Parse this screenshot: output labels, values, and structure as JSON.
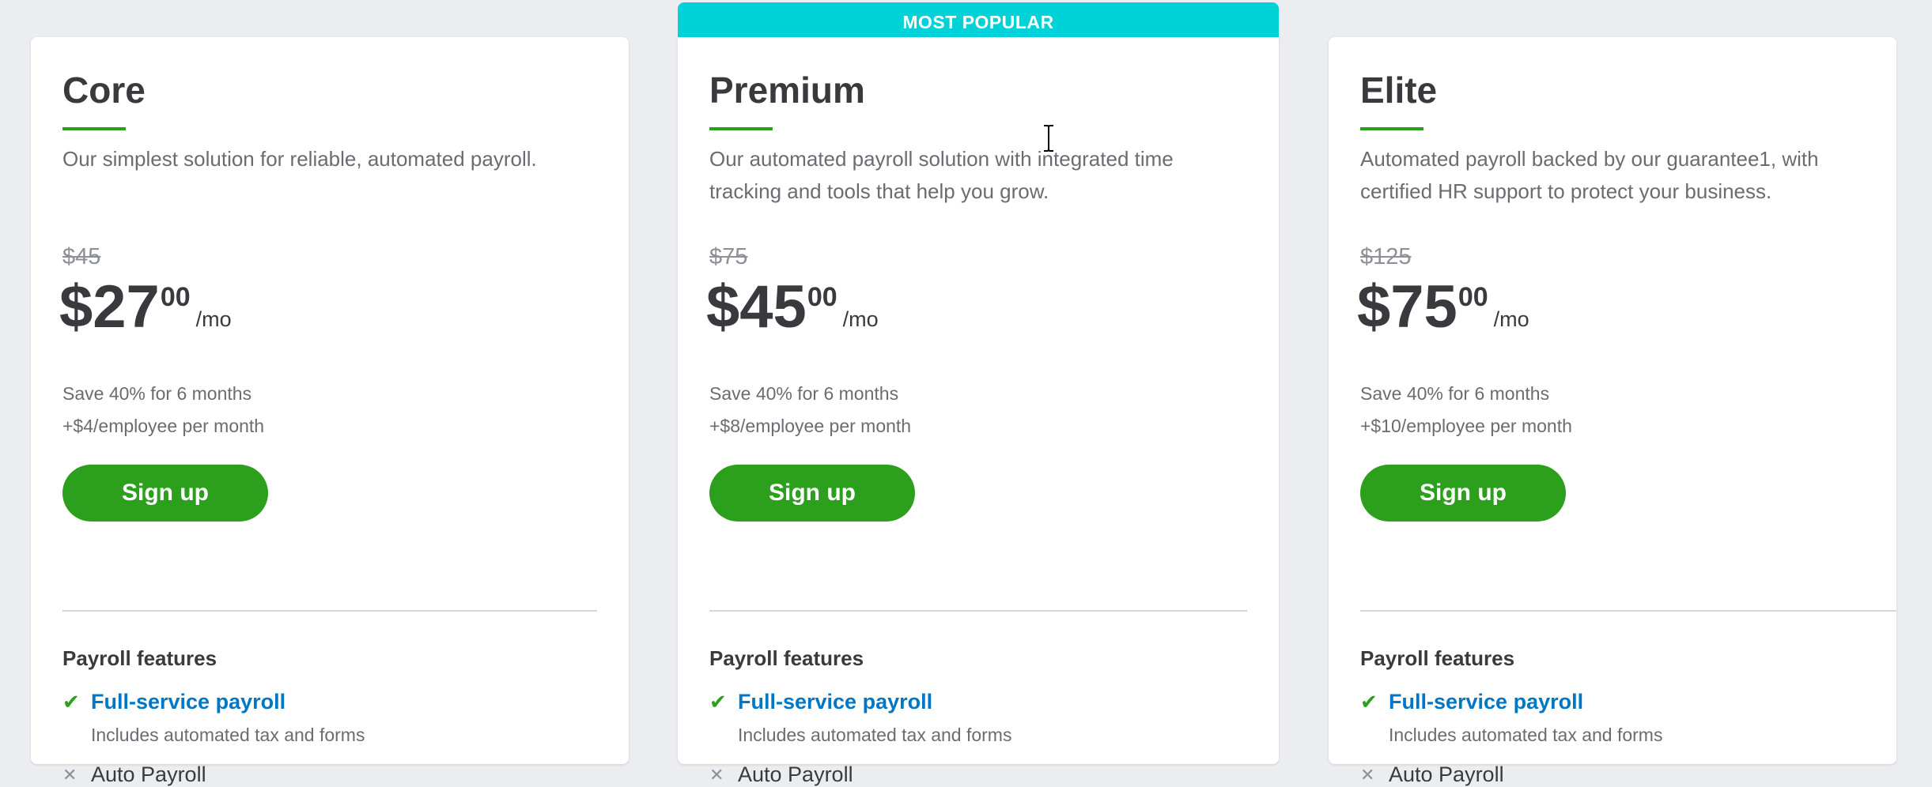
{
  "banner": {
    "label": "MOST POPULAR"
  },
  "colors": {
    "accent_green": "#2ca01c",
    "banner_teal": "#00d3d7",
    "link_blue": "#0077c5",
    "background": "#ebedf0"
  },
  "plans": [
    {
      "name": "Core",
      "description": "Our simplest solution for reliable, automated payroll.",
      "old_price": "$45",
      "price_main": "$27",
      "price_cents": "00",
      "price_per": "/mo",
      "promo": "Save 40% for 6 months",
      "per_employee": "+$4/employee per month",
      "signup_label": "Sign up",
      "features_heading": "Payroll features",
      "feature_check_icon": "✔",
      "feature1_link": "Full-service payroll",
      "feature1_sub": "Includes automated tax and forms",
      "feature2_icon": "✕",
      "feature2_label": "Auto Payroll"
    },
    {
      "name": "Premium",
      "description": "Our automated payroll solution with integrated time tracking and tools that help you grow.",
      "old_price": "$75",
      "price_main": "$45",
      "price_cents": "00",
      "price_per": "/mo",
      "promo": "Save 40% for 6 months",
      "per_employee": "+$8/employee per month",
      "signup_label": "Sign up",
      "features_heading": "Payroll features",
      "feature_check_icon": "✔",
      "feature1_link": "Full-service payroll",
      "feature1_sub": "Includes automated tax and forms",
      "feature2_icon": "✕",
      "feature2_label": "Auto Payroll"
    },
    {
      "name": "Elite",
      "description": "Automated payroll backed by our guarantee1, with certified HR support to protect your business.",
      "old_price": "$125",
      "price_main": "$75",
      "price_cents": "00",
      "price_per": "/mo",
      "promo": "Save 40% for 6 months",
      "per_employee": "+$10/employee per month",
      "signup_label": "Sign up",
      "features_heading": "Payroll features",
      "feature_check_icon": "✔",
      "feature1_link": "Full-service payroll",
      "feature1_sub": "Includes automated tax and forms",
      "feature2_icon": "✕",
      "feature2_label": "Auto Payroll"
    }
  ]
}
